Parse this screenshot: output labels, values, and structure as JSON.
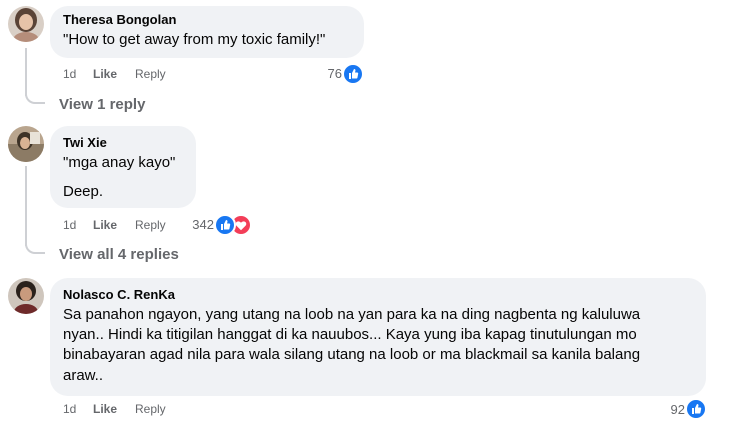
{
  "comments": [
    {
      "author": "Theresa Bongolan",
      "lines": [
        "\"How to get away from my toxic family!\""
      ],
      "time": "1d",
      "like_label": "Like",
      "reply_label": "Reply",
      "reaction_count": "76",
      "reactions": [
        "like-icon"
      ],
      "view_replies": "View 1 reply"
    },
    {
      "author": "Twi Xie",
      "lines": [
        "\"mga anay kayo\"",
        "Deep."
      ],
      "time": "1d",
      "like_label": "Like",
      "reply_label": "Reply",
      "reaction_count": "342",
      "reactions": [
        "like-icon",
        "love-icon"
      ],
      "view_replies": "View all 4 replies"
    },
    {
      "author": "Nolasco C. RenKa",
      "lines": [
        "Sa panahon ngayon, yang utang na loob na yan para ka na ding nagbenta ng kaluluwa",
        "nyan.. Hindi ka titigilan hanggat di ka nauubos... Kaya yung iba kapag tinutulungan mo",
        "binabayaran agad nila para wala silang utang na loob or ma blackmail sa kanila balang",
        "araw.."
      ],
      "time": "1d",
      "like_label": "Like",
      "reply_label": "Reply",
      "reaction_count": "92",
      "reactions": [
        "like-icon"
      ]
    }
  ],
  "colors": {
    "bubble": "#f0f2f5",
    "secondary_text": "#65676b",
    "like_blue": "#1877f2",
    "love_red": "#f33e58",
    "thread_line": "#ced0d4"
  }
}
